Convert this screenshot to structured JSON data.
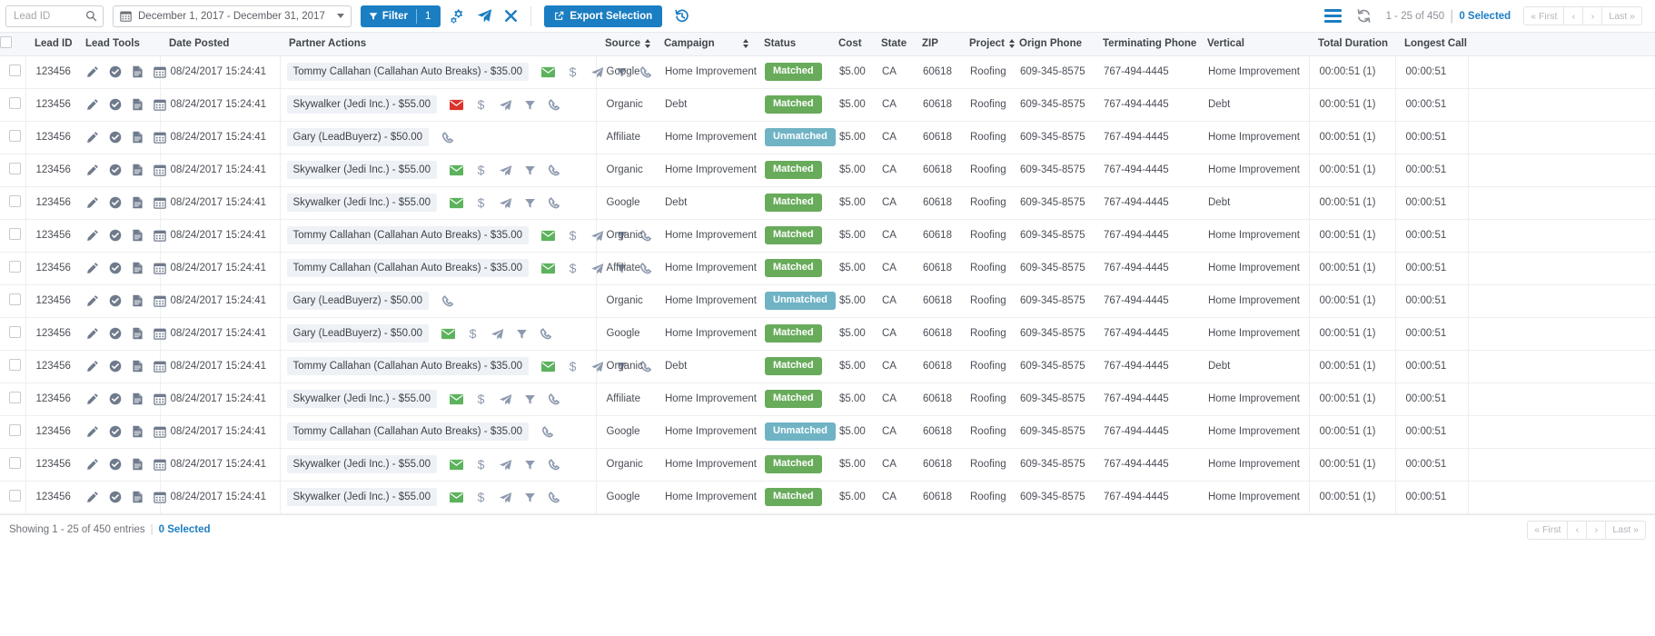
{
  "toolbar": {
    "search": {
      "placeholder": "Lead ID",
      "value": "",
      "icon": "search-icon"
    },
    "date_range": {
      "value": "December 1, 2017 - December 31, 2017",
      "icon": "calendar-icon"
    },
    "filter_button": {
      "label": "Filter",
      "count": "1",
      "icon": "funnel-icon"
    },
    "icons": [
      {
        "name": "gears-icon",
        "title": "Settings"
      },
      {
        "name": "paper-plane-icon",
        "title": "Send"
      },
      {
        "name": "close-x-icon",
        "title": "Clear"
      }
    ],
    "export_button": {
      "label": "Export Selection",
      "icon": "external-link-icon"
    },
    "undo_icon": "undo-history-icon",
    "right": {
      "menu_icon": "hamburger-menu-icon",
      "refresh_icon": "refresh-icon",
      "range_text": "1 - 25 of 450",
      "separator": "|",
      "selected_text": "0 Selected",
      "pager": [
        "« First",
        "‹",
        "›",
        "Last »"
      ]
    },
    "accent_color": "#1b7ec2"
  },
  "table": {
    "columns": [
      {
        "key": "check",
        "label": "",
        "sortable": false
      },
      {
        "key": "lead_id",
        "label": "Lead ID",
        "sortable": false
      },
      {
        "key": "tools",
        "label": "Lead Tools",
        "sortable": false
      },
      {
        "key": "date",
        "label": "Date Posted",
        "sortable": false
      },
      {
        "key": "partner",
        "label": "Partner Actions",
        "sortable": false
      },
      {
        "key": "source",
        "label": "Source",
        "sortable": true
      },
      {
        "key": "camp",
        "label": "Campaign",
        "sortable": true
      },
      {
        "key": "status",
        "label": "Status",
        "sortable": false
      },
      {
        "key": "cost",
        "label": "Cost",
        "sortable": false
      },
      {
        "key": "state",
        "label": "State",
        "sortable": false
      },
      {
        "key": "zip",
        "label": "ZIP",
        "sortable": false
      },
      {
        "key": "proj",
        "label": "Project",
        "sortable": true
      },
      {
        "key": "ophone",
        "label": "Orign Phone",
        "sortable": false
      },
      {
        "key": "tphone",
        "label": "Terminating Phone",
        "sortable": false
      },
      {
        "key": "vert",
        "label": "Vertical",
        "sortable": false
      },
      {
        "key": "totdur",
        "label": "Total Duration",
        "sortable": false
      },
      {
        "key": "long",
        "label": "Longest Call",
        "sortable": false
      }
    ],
    "lead_tool_icons": [
      "pencil-icon",
      "check-circle-icon",
      "file-icon",
      "calendar-icon"
    ],
    "rows": [
      {
        "lead_id": "123456",
        "date": "08/24/2017 15:24:41",
        "partner": "Tommy Callahan (Callahan Auto Breaks) - $35.00",
        "actions": [
          "envelope-green",
          "dollar",
          "paper-plane",
          "funnel",
          "phone"
        ],
        "source": "Google",
        "campaign": "Home Improvement",
        "status": "Matched",
        "cost": "$5.00",
        "state": "CA",
        "zip": "60618",
        "project": "Roofing",
        "orign_phone": "609-345-8575",
        "terminating_phone": "767-494-4445",
        "vertical": "Home Improvement",
        "total_duration": "00:00:51 (1)",
        "longest_call": "00:00:51"
      },
      {
        "lead_id": "123456",
        "date": "08/24/2017 15:24:41",
        "partner": "Skywalker (Jedi Inc.) - $55.00",
        "actions": [
          "envelope-red",
          "dollar",
          "paper-plane",
          "funnel",
          "phone"
        ],
        "source": "Organic",
        "campaign": "Debt",
        "status": "Matched",
        "cost": "$5.00",
        "state": "CA",
        "zip": "60618",
        "project": "Roofing",
        "orign_phone": "609-345-8575",
        "terminating_phone": "767-494-4445",
        "vertical": "Debt",
        "total_duration": "00:00:51 (1)",
        "longest_call": "00:00:51"
      },
      {
        "lead_id": "123456",
        "date": "08/24/2017 15:24:41",
        "partner": "Gary (LeadBuyerz) - $50.00",
        "actions": [
          "phone"
        ],
        "source": "Affiliate",
        "campaign": "Home Improvement",
        "status": "Unmatched",
        "cost": "$5.00",
        "state": "CA",
        "zip": "60618",
        "project": "Roofing",
        "orign_phone": "609-345-8575",
        "terminating_phone": "767-494-4445",
        "vertical": "Home Improvement",
        "total_duration": "00:00:51 (1)",
        "longest_call": "00:00:51"
      },
      {
        "lead_id": "123456",
        "date": "08/24/2017 15:24:41",
        "partner": "Skywalker (Jedi Inc.) - $55.00",
        "actions": [
          "envelope-green",
          "dollar",
          "paper-plane",
          "funnel",
          "phone"
        ],
        "source": "Organic",
        "campaign": "Home Improvement",
        "status": "Matched",
        "cost": "$5.00",
        "state": "CA",
        "zip": "60618",
        "project": "Roofing",
        "orign_phone": "609-345-8575",
        "terminating_phone": "767-494-4445",
        "vertical": "Home Improvement",
        "total_duration": "00:00:51 (1)",
        "longest_call": "00:00:51"
      },
      {
        "lead_id": "123456",
        "date": "08/24/2017 15:24:41",
        "partner": "Skywalker (Jedi Inc.) - $55.00",
        "actions": [
          "envelope-green",
          "dollar",
          "paper-plane",
          "funnel",
          "phone"
        ],
        "source": "Google",
        "campaign": "Debt",
        "status": "Matched",
        "cost": "$5.00",
        "state": "CA",
        "zip": "60618",
        "project": "Roofing",
        "orign_phone": "609-345-8575",
        "terminating_phone": "767-494-4445",
        "vertical": "Debt",
        "total_duration": "00:00:51 (1)",
        "longest_call": "00:00:51"
      },
      {
        "lead_id": "123456",
        "date": "08/24/2017 15:24:41",
        "partner": "Tommy Callahan (Callahan Auto Breaks) - $35.00",
        "actions": [
          "envelope-green",
          "dollar",
          "paper-plane",
          "funnel",
          "phone"
        ],
        "source": "Organic",
        "campaign": "Home Improvement",
        "status": "Matched",
        "cost": "$5.00",
        "state": "CA",
        "zip": "60618",
        "project": "Roofing",
        "orign_phone": "609-345-8575",
        "terminating_phone": "767-494-4445",
        "vertical": "Home Improvement",
        "total_duration": "00:00:51 (1)",
        "longest_call": "00:00:51"
      },
      {
        "lead_id": "123456",
        "date": "08/24/2017 15:24:41",
        "partner": "Tommy Callahan (Callahan Auto Breaks) - $35.00",
        "actions": [
          "envelope-green",
          "dollar",
          "paper-plane",
          "funnel",
          "phone"
        ],
        "source": "Affiliate",
        "campaign": "Home Improvement",
        "status": "Matched",
        "cost": "$5.00",
        "state": "CA",
        "zip": "60618",
        "project": "Roofing",
        "orign_phone": "609-345-8575",
        "terminating_phone": "767-494-4445",
        "vertical": "Home Improvement",
        "total_duration": "00:00:51 (1)",
        "longest_call": "00:00:51"
      },
      {
        "lead_id": "123456",
        "date": "08/24/2017 15:24:41",
        "partner": "Gary (LeadBuyerz) - $50.00",
        "actions": [
          "phone"
        ],
        "source": "Organic",
        "campaign": "Home Improvement",
        "status": "Unmatched",
        "cost": "$5.00",
        "state": "CA",
        "zip": "60618",
        "project": "Roofing",
        "orign_phone": "609-345-8575",
        "terminating_phone": "767-494-4445",
        "vertical": "Home Improvement",
        "total_duration": "00:00:51 (1)",
        "longest_call": "00:00:51"
      },
      {
        "lead_id": "123456",
        "date": "08/24/2017 15:24:41",
        "partner": "Gary (LeadBuyerz) - $50.00",
        "actions": [
          "envelope-green",
          "dollar",
          "paper-plane",
          "funnel",
          "phone"
        ],
        "source": "Google",
        "campaign": "Home Improvement",
        "status": "Matched",
        "cost": "$5.00",
        "state": "CA",
        "zip": "60618",
        "project": "Roofing",
        "orign_phone": "609-345-8575",
        "terminating_phone": "767-494-4445",
        "vertical": "Home Improvement",
        "total_duration": "00:00:51 (1)",
        "longest_call": "00:00:51"
      },
      {
        "lead_id": "123456",
        "date": "08/24/2017 15:24:41",
        "partner": "Tommy Callahan (Callahan Auto Breaks) - $35.00",
        "actions": [
          "envelope-green",
          "dollar",
          "paper-plane",
          "funnel",
          "phone"
        ],
        "source": "Organic",
        "campaign": "Debt",
        "status": "Matched",
        "cost": "$5.00",
        "state": "CA",
        "zip": "60618",
        "project": "Roofing",
        "orign_phone": "609-345-8575",
        "terminating_phone": "767-494-4445",
        "vertical": "Debt",
        "total_duration": "00:00:51 (1)",
        "longest_call": "00:00:51"
      },
      {
        "lead_id": "123456",
        "date": "08/24/2017 15:24:41",
        "partner": "Skywalker (Jedi Inc.) - $55.00",
        "actions": [
          "envelope-green",
          "dollar",
          "paper-plane",
          "funnel",
          "phone"
        ],
        "source": "Affiliate",
        "campaign": "Home Improvement",
        "status": "Matched",
        "cost": "$5.00",
        "state": "CA",
        "zip": "60618",
        "project": "Roofing",
        "orign_phone": "609-345-8575",
        "terminating_phone": "767-494-4445",
        "vertical": "Home Improvement",
        "total_duration": "00:00:51 (1)",
        "longest_call": "00:00:51"
      },
      {
        "lead_id": "123456",
        "date": "08/24/2017 15:24:41",
        "partner": "Tommy Callahan (Callahan Auto Breaks) - $35.00",
        "actions": [
          "phone"
        ],
        "source": "Google",
        "campaign": "Home Improvement",
        "status": "Unmatched",
        "cost": "$5.00",
        "state": "CA",
        "zip": "60618",
        "project": "Roofing",
        "orign_phone": "609-345-8575",
        "terminating_phone": "767-494-4445",
        "vertical": "Home Improvement",
        "total_duration": "00:00:51 (1)",
        "longest_call": "00:00:51"
      },
      {
        "lead_id": "123456",
        "date": "08/24/2017 15:24:41",
        "partner": "Skywalker (Jedi Inc.) - $55.00",
        "actions": [
          "envelope-green",
          "dollar",
          "paper-plane",
          "funnel",
          "phone"
        ],
        "source": "Organic",
        "campaign": "Home Improvement",
        "status": "Matched",
        "cost": "$5.00",
        "state": "CA",
        "zip": "60618",
        "project": "Roofing",
        "orign_phone": "609-345-8575",
        "terminating_phone": "767-494-4445",
        "vertical": "Home Improvement",
        "total_duration": "00:00:51 (1)",
        "longest_call": "00:00:51"
      },
      {
        "lead_id": "123456",
        "date": "08/24/2017 15:24:41",
        "partner": "Skywalker (Jedi Inc.) - $55.00",
        "actions": [
          "envelope-green",
          "dollar",
          "paper-plane",
          "funnel",
          "phone"
        ],
        "source": "Google",
        "campaign": "Home Improvement",
        "status": "Matched",
        "cost": "$5.00",
        "state": "CA",
        "zip": "60618",
        "project": "Roofing",
        "orign_phone": "609-345-8575",
        "terminating_phone": "767-494-4445",
        "vertical": "Home Improvement",
        "total_duration": "00:00:51 (1)",
        "longest_call": "00:00:51"
      }
    ]
  },
  "footer": {
    "showing_text": "Showing 1 - 25 of 450 entries",
    "separator": "|",
    "selected_text": "0 Selected",
    "pager": [
      "« First",
      "‹",
      "›",
      "Last »"
    ]
  },
  "colors": {
    "accent": "#1b7ec2",
    "matched": "#68ab5b",
    "unmatched": "#6fb3c4",
    "envelope_green": "#5cb25d",
    "envelope_red": "#d9342b",
    "icon_grey": "#8d99ae"
  }
}
